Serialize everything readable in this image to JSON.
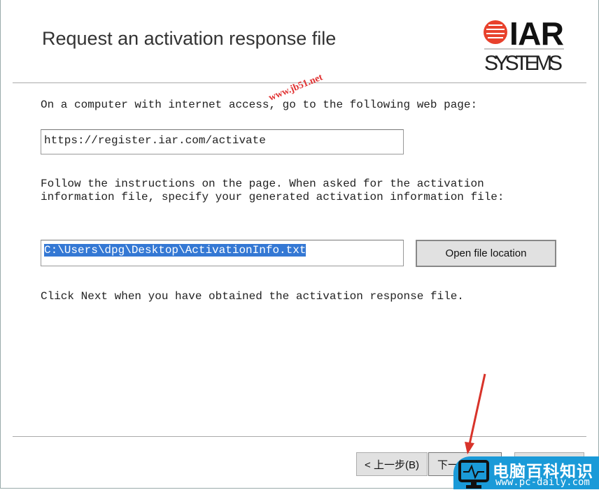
{
  "title": "Request an activation response file",
  "logo": {
    "top": "IAR",
    "bottom": "SYSTEMS",
    "color": "#e8412c"
  },
  "watermark": "www.jb51.net",
  "instruction1": "On a computer with internet access, go to the following web page:",
  "url_value": "https://register.iar.com/activate",
  "instruction2_line1": "Follow the instructions on the page. When asked for the activation",
  "instruction2_line2": "information file, specify your generated activation information file:",
  "file_path": "C:\\Users\\dpg\\Desktop\\ActivationInfo.txt",
  "open_file_location": "Open file location",
  "instruction3": "Click Next when you have obtained the activation response file.",
  "buttons": {
    "back": "< 上一步(B)",
    "next": "下一步(N) >"
  },
  "site_badge": {
    "title": "电脑百科知识",
    "url": "www.pc-daily.com"
  },
  "colors": {
    "selection": "#3478d4",
    "arrow": "#d8332a",
    "badge": "#1a9ad8"
  }
}
